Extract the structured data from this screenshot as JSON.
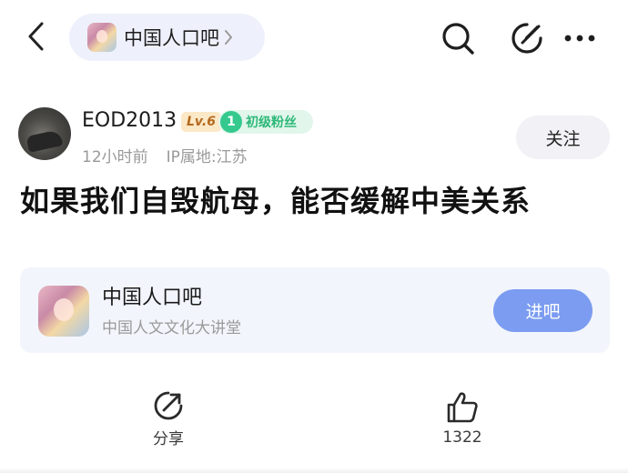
{
  "topbar": {
    "forum_name": "中国人口吧",
    "icons": [
      "back-icon",
      "chevron-right-icon",
      "search-icon",
      "edit-icon",
      "more-icon"
    ]
  },
  "author": {
    "username": "EOD2013",
    "level": "Lv.6",
    "fan_level": "1",
    "fan_badge": "初级粉丝",
    "time": "12小时前",
    "ip_location": "IP属地:江苏",
    "follow_label": "关注"
  },
  "post": {
    "title": "如果我们自毁航母，能否缓解中美关系"
  },
  "forum_card": {
    "name": "中国人口吧",
    "description": "中国人文文化大讲堂",
    "enter_label": "进吧"
  },
  "actions": {
    "share_label": "分享",
    "like_count": "1322"
  },
  "colors": {
    "accent": "#7b9cf0",
    "pill_bg": "#eef1fb",
    "fan_green": "#2db878",
    "level_orange": "#b4691e"
  }
}
